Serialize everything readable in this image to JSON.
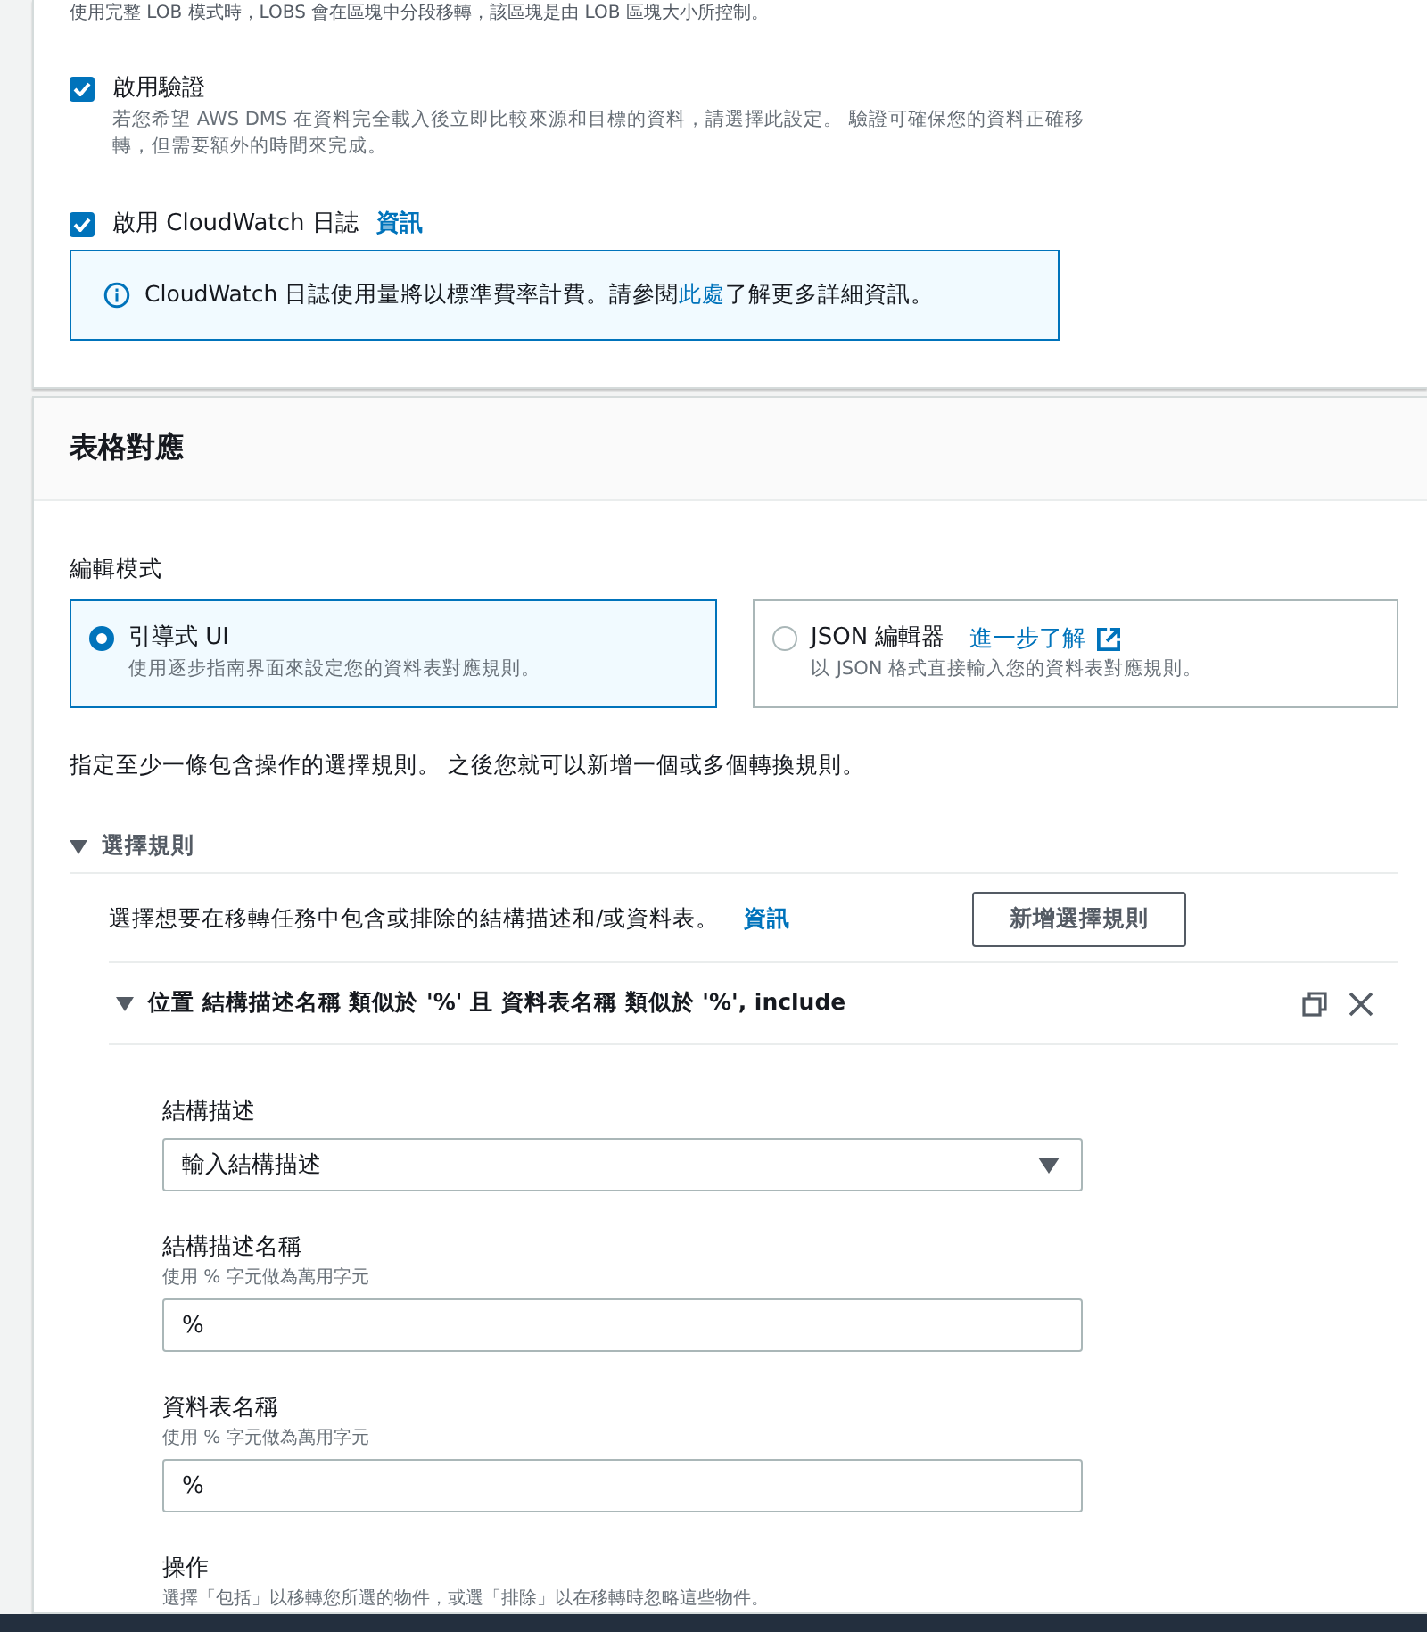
{
  "top_note": "使用完整 LOB 模式時，LOBS 會在區塊中分段移轉，該區塊是由 LOB 區塊大小所控制。",
  "options": [
    {
      "kind": "checkbox",
      "label": "啟用驗證",
      "checked": true,
      "description": "若您希望 AWS DMS 在資料完全載入後立即比較來源和目標的資料，請選擇此設定。 驗證可確保您的資料正確移轉，但需要額外的時間來完成。"
    },
    {
      "kind": "checkbox",
      "label": "啟用 CloudWatch 日誌",
      "checked": true,
      "info": "資訊",
      "alert": {
        "before": "CloudWatch 日誌使用量將以標準費率計費。請參閱",
        "link": "此處",
        "after": "了解更多詳細資訊。"
      }
    }
  ],
  "table_mapping": {
    "title": "表格對應",
    "edit_mode": {
      "label": "編輯模式",
      "choices": [
        {
          "label": "引導式 UI",
          "description": "使用逐步指南界面來設定您的資料表對應規則。",
          "selected": true
        },
        {
          "label": "JSON 編輯器",
          "link": "進一步了解",
          "description": "以 JSON 格式直接輸入您的資料表對應規則。",
          "selected": false
        }
      ]
    },
    "hint": "指定至少一條包含操作的選擇規則。 之後您就可以新增一個或多個轉換規則。",
    "selection_rules": {
      "title": "選擇規則",
      "expanded": true,
      "description": "選擇想要在移轉任務中包含或排除的結構描述和/或資料表。",
      "info": "資訊",
      "add_button": "新增選擇規則",
      "rule": {
        "title": "位置 結構描述名稱 類似於 '%' 且 資料表名稱 類似於 '%', include",
        "expanded": true,
        "fields": [
          {
            "kind": "select",
            "label": "結構描述",
            "value": "輸入結構描述"
          },
          {
            "kind": "text",
            "label": "結構描述名稱",
            "hint": "使用 % 字元做為萬用字元",
            "value": "%"
          },
          {
            "kind": "text",
            "label": "資料表名稱",
            "hint": "使用 % 字元做為萬用字元",
            "value": "%"
          },
          {
            "kind": "label",
            "label": "操作",
            "hint": "選擇「包括」以移轉您所選的物件，或選「排除」以在移轉時忽略這些物件。"
          }
        ]
      }
    }
  }
}
